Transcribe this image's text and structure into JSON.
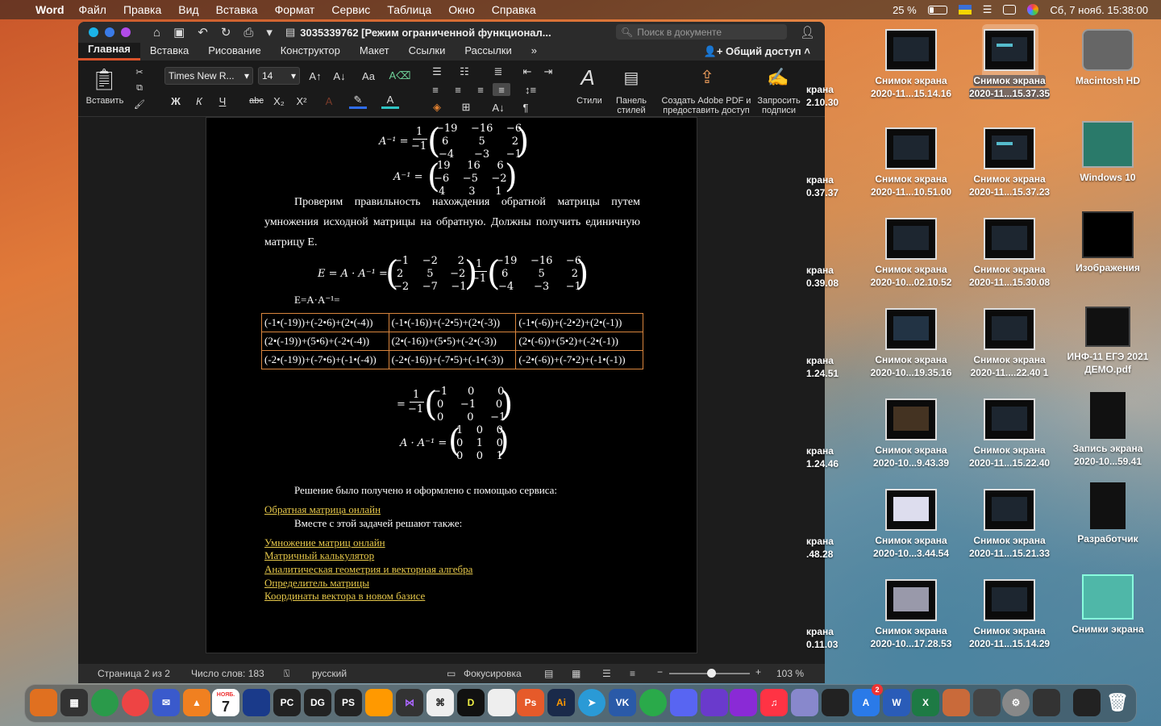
{
  "menubar": {
    "apple": "",
    "app_name": "Word",
    "items": [
      "Файл",
      "Правка",
      "Вид",
      "Вставка",
      "Формат",
      "Сервис",
      "Таблица",
      "Окно",
      "Справка"
    ],
    "battery": "25 %",
    "datetime": "Сб, 7 нояб.  15:38:00"
  },
  "window": {
    "title": "3035339762 [Режим ограниченной функционал...",
    "search_placeholder": "Поиск в документе",
    "tabs": [
      "Главная",
      "Вставка",
      "Рисование",
      "Конструктор",
      "Макет",
      "Ссылки",
      "Рассылки"
    ],
    "more_tabs": "»",
    "share": "Общий доступ",
    "ribbon": {
      "paste": "Вставить",
      "font_name": "Times New R...",
      "font_size": "14",
      "bold": "Ж",
      "italic": "К",
      "underline": "Ч",
      "strike": "abc",
      "subscript": "X₂",
      "superscript": "X²",
      "styles": "Стили",
      "styles_pane": "Панель стилей",
      "adobe": "Создать Adobe PDF и предоставить доступ",
      "signature": "Запросить подписи"
    }
  },
  "document": {
    "paragraph1": "Проверим правильность нахождения обратной матрицы путем умножения исходной матрицы на обратную. Должны получить единичную матрицу E.",
    "eq_label": "E=A·A⁻¹=",
    "table": [
      [
        "(-1•(-19))+(-2•6)+(2•(-4))",
        "(-1•(-16))+(-2•5)+(2•(-3))",
        "(-1•(-6))+(-2•2)+(2•(-1))"
      ],
      [
        "(2•(-19))+(5•6)+(-2•(-4))",
        "(2•(-16))+(5•5)+(-2•(-3))",
        "(2•(-6))+(5•2)+(-2•(-1))"
      ],
      [
        "(-2•(-19))+(-7•6)+(-1•(-4))",
        "(-2•(-16))+(-7•5)+(-1•(-3))",
        "(-2•(-6))+(-7•2)+(-1•(-1))"
      ]
    ],
    "solution_text": "Решение было получено и оформлено с помощью сервиса:",
    "solution_link": "Обратная матрица онлайн",
    "also_text": "Вместе с этой задачей решают также:",
    "links": [
      "Умножение матриц онлайн",
      "Матричный калькулятор",
      "Аналитическая геометрия и векторная алгебра",
      "Определитель матрицы",
      "Координаты вектора в новом базисе"
    ]
  },
  "statusbar": {
    "page": "Страница 2 из 2",
    "words": "Число слов: 183",
    "language": "русский",
    "focus": "Фокусировка",
    "zoom": "103 %"
  },
  "desktop": {
    "icons": [
      {
        "line1": "Снимок экрана",
        "line2": "2020-11...15.14.16"
      },
      {
        "line1": "Снимок экрана",
        "line2": "2020-11...15.37.35"
      },
      {
        "line1": "Macintosh HD",
        "line2": ""
      },
      {
        "line1": "Снимок экрана",
        "line2": "2020-11...10.51.00"
      },
      {
        "line1": "Снимок экрана",
        "line2": "2020-11...15.37.23"
      },
      {
        "line1": "Windows 10",
        "line2": ""
      },
      {
        "line1": "Снимок экрана",
        "line2": "2020-10...02.10.52"
      },
      {
        "line1": "Снимок экрана",
        "line2": "2020-11...15.30.08"
      },
      {
        "line1": "Изображения",
        "line2": ""
      },
      {
        "line1": "Снимок экрана",
        "line2": "2020-10...19.35.16"
      },
      {
        "line1": "Снимок экрана",
        "line2": "2020-11....22.40 1"
      },
      {
        "line1": "ИНФ-11 ЕГЭ 2021",
        "line2": "ДЕМО.pdf"
      },
      {
        "line1": "Снимок экрана",
        "line2": "2020-10...9.43.39"
      },
      {
        "line1": "Снимок экрана",
        "line2": "2020-11...15.22.40"
      },
      {
        "line1": "Запись экрана",
        "line2": "2020-10...59.41"
      },
      {
        "line1": "Снимок экрана",
        "line2": "2020-10...3.44.54"
      },
      {
        "line1": "Снимок экрана",
        "line2": "2020-11...15.21.33"
      },
      {
        "line1": "Разработчик",
        "line2": ""
      },
      {
        "line1": "Снимок экрана",
        "line2": "2020-10...17.28.53"
      },
      {
        "line1": "Снимок экрана",
        "line2": "2020-11...15.14.29"
      },
      {
        "line1": "Снимки экрана",
        "line2": ""
      }
    ],
    "partial_labels": [
      {
        "line1": "крана",
        "line2": "2.10.30"
      },
      {
        "line1": "крана",
        "line2": "0.37.37"
      },
      {
        "line1": "крана",
        "line2": "0.39.08"
      },
      {
        "line1": "крана",
        "line2": "1.24.51"
      },
      {
        "line1": "крана",
        "line2": "1.24.46"
      },
      {
        "line1": "крана",
        "line2": ".48.28"
      },
      {
        "line1": "крана",
        "line2": "0.11.03"
      }
    ]
  },
  "dock": {
    "calendar_month": "НОЯБ.",
    "calendar_day": "7",
    "badge": "2"
  }
}
